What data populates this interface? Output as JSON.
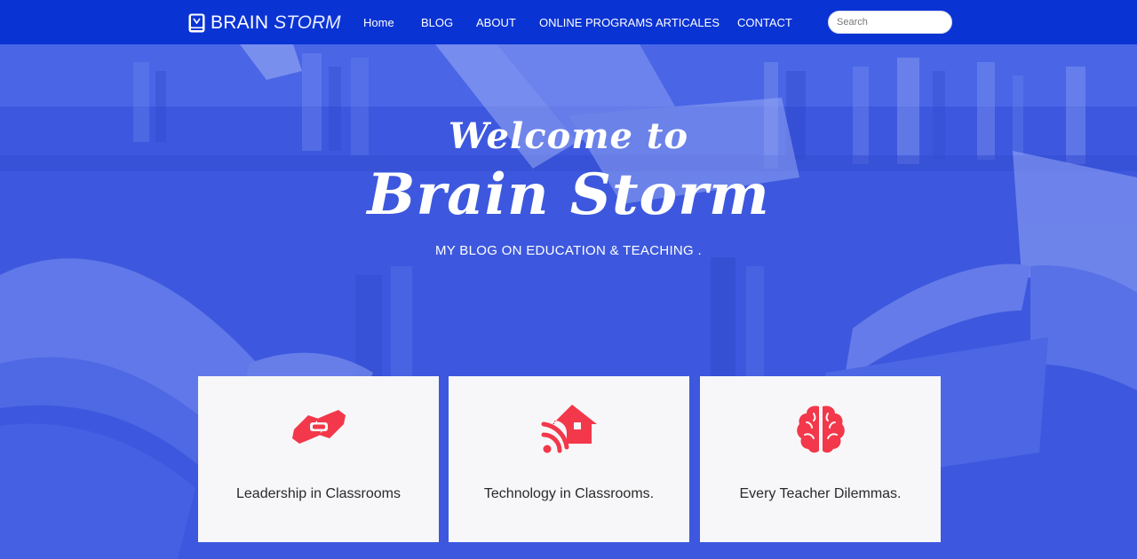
{
  "brand": {
    "word1": "BRAIN",
    "word2": "STORM",
    "logo_icon": "book-logo-icon"
  },
  "nav": {
    "items": [
      {
        "label": "Home"
      },
      {
        "label": "BLOG"
      },
      {
        "label": "ABOUT"
      },
      {
        "label": "ONLINE PROGRAMS"
      },
      {
        "label": "ARTICALES"
      },
      {
        "label": "CONTACT"
      }
    ]
  },
  "search": {
    "placeholder": "Search",
    "value": ""
  },
  "hero": {
    "welcome": "Welcome to",
    "headline": "Brain Storm",
    "tagline": "MY BLOG ON EDUCATION & TEACHING ."
  },
  "cards": [
    {
      "title": "Leadership in Classrooms",
      "icon": "handshake-icon"
    },
    {
      "title": "Technology in Classrooms.",
      "icon": "smart-home-icon"
    },
    {
      "title": "Every Teacher Dilemmas.",
      "icon": "brain-icon"
    }
  ],
  "colors": {
    "navbar": "#0a33d4",
    "hero_overlay": "#3f5be0",
    "card_bg": "#f7f7f9",
    "icon_accent": "#f2384a",
    "text_white": "#ffffff"
  }
}
